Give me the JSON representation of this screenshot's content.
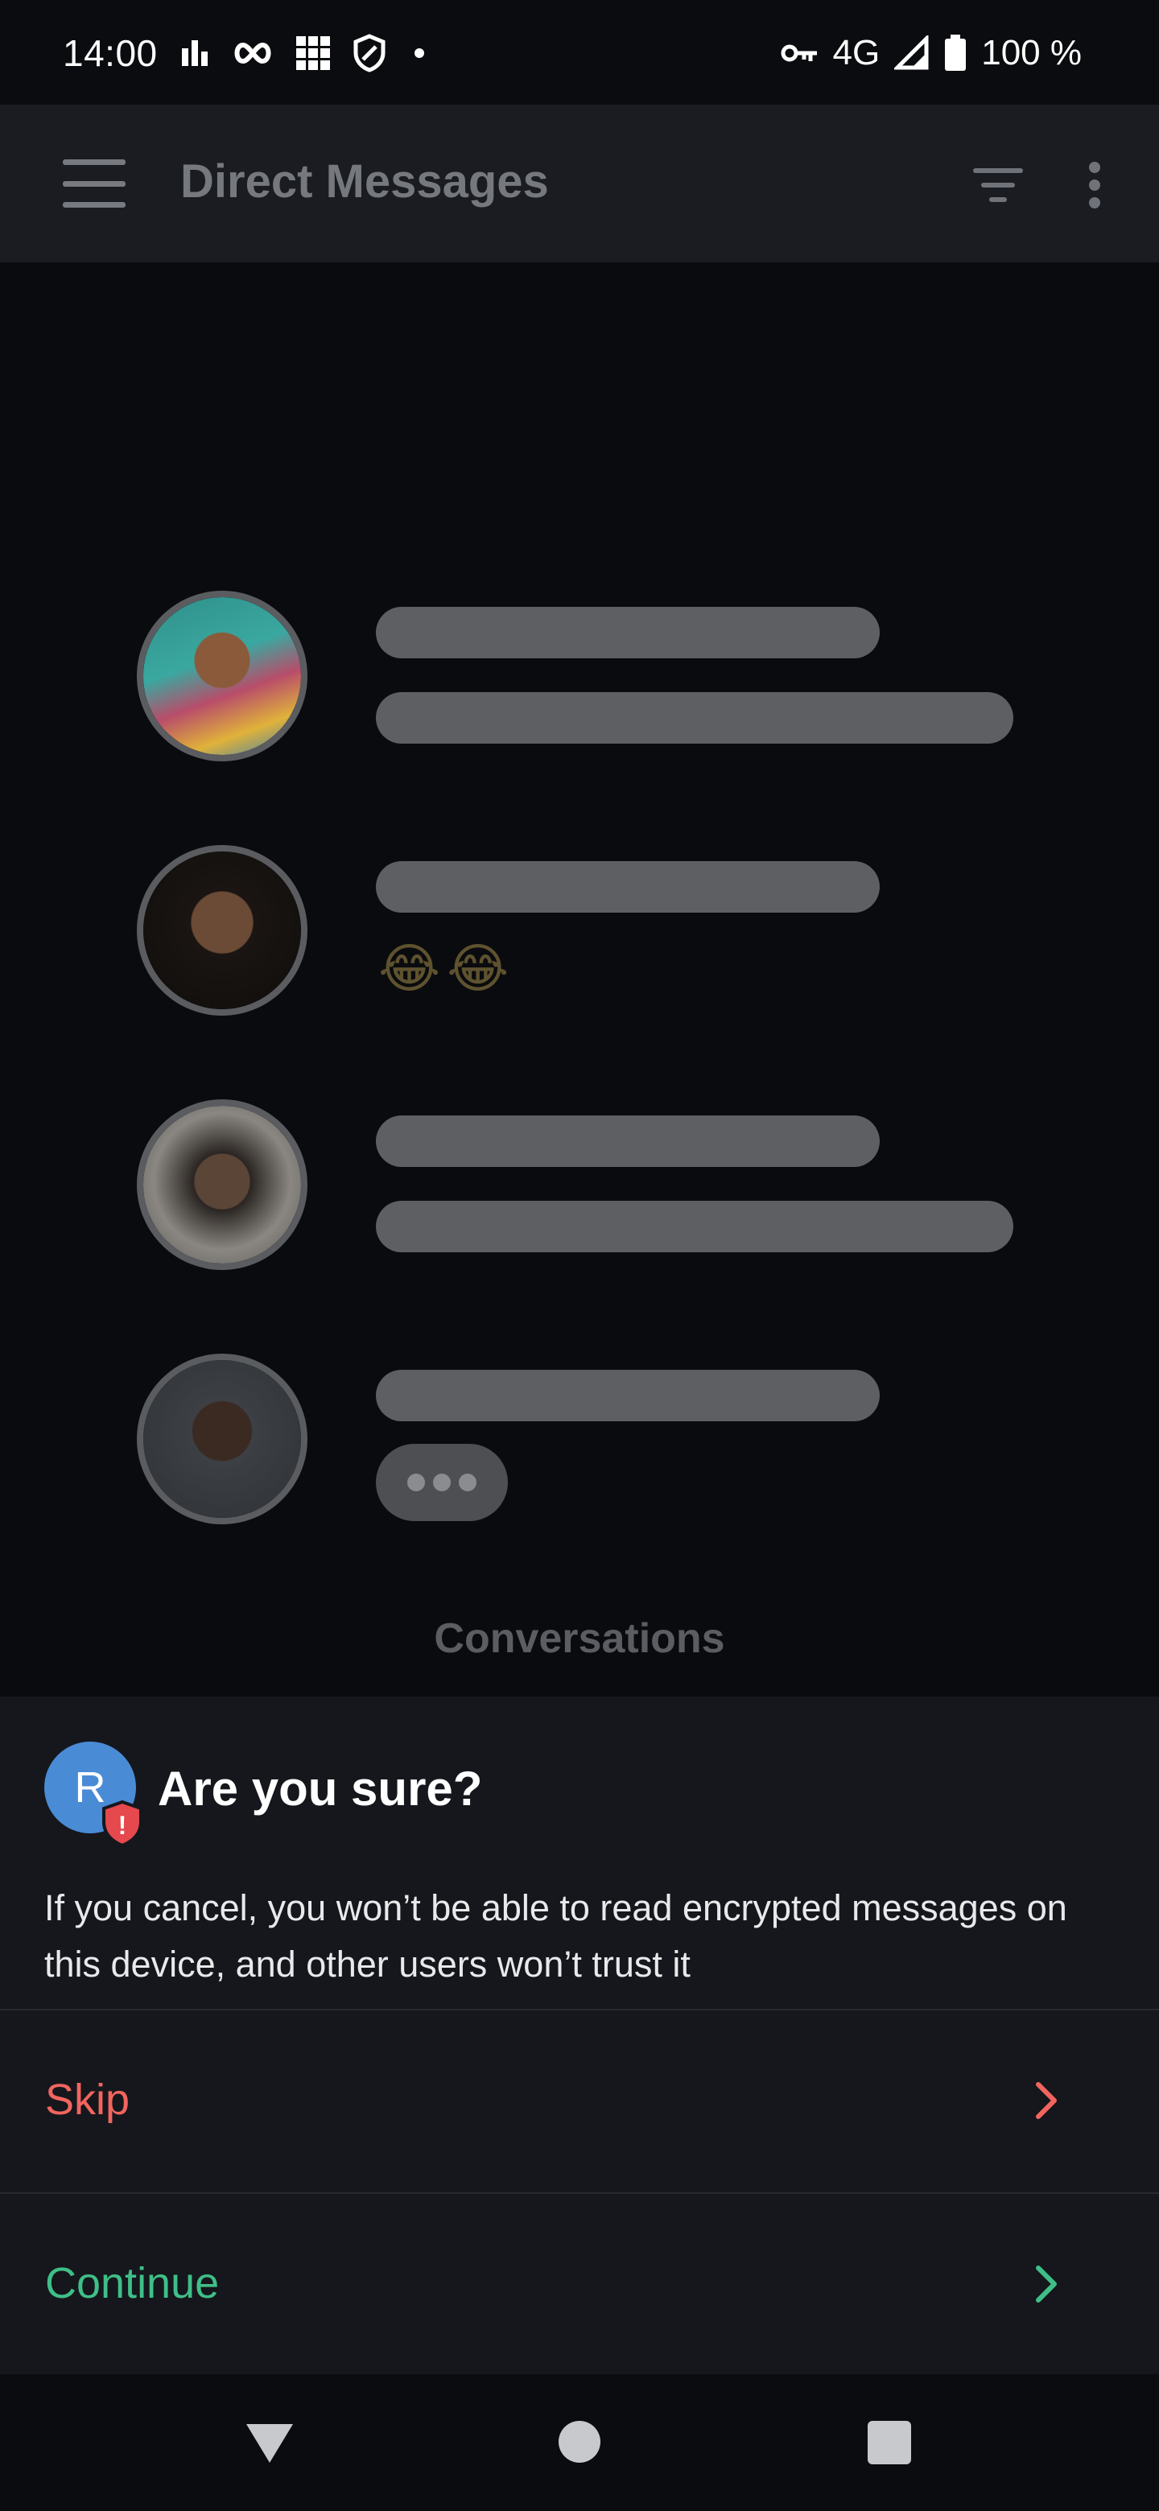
{
  "status_bar": {
    "time": "14:00",
    "network": "4G",
    "battery": "100 %",
    "icons": [
      "bar-chart-icon",
      "infinity-icon",
      "grid-icon",
      "shield-icon",
      "dot-icon",
      "vpn-key-icon",
      "signal-icon",
      "battery-icon"
    ]
  },
  "app_bar": {
    "title": "Direct Messages",
    "icons": [
      "menu-icon",
      "filter-icon",
      "more-vert-icon"
    ]
  },
  "conversations": {
    "rows": [
      {
        "avatar_color": "#3aa8a0",
        "preview": "bars"
      },
      {
        "avatar_color": "#2c2420",
        "preview": "😂😂"
      },
      {
        "avatar_color": "#6d6a66",
        "preview": "bars"
      },
      {
        "avatar_color": "#3a3d40",
        "preview": "typing"
      }
    ],
    "label": "Conversations"
  },
  "sheet": {
    "avatar_initial": "R",
    "badge_mark": "!",
    "title": "Are you sure?",
    "body": "If you cancel, you won’t be able to read encrypted messages on this device, and other users won’t trust it",
    "actions": [
      {
        "label": "Skip",
        "color": "#f2655f"
      },
      {
        "label": "Continue",
        "color": "#3fbf88"
      }
    ]
  },
  "colors": {
    "accent_avatar": "#4a8bd6",
    "danger": "#f2655f",
    "success": "#3fbf88",
    "sheet_bg": "#15171c"
  }
}
